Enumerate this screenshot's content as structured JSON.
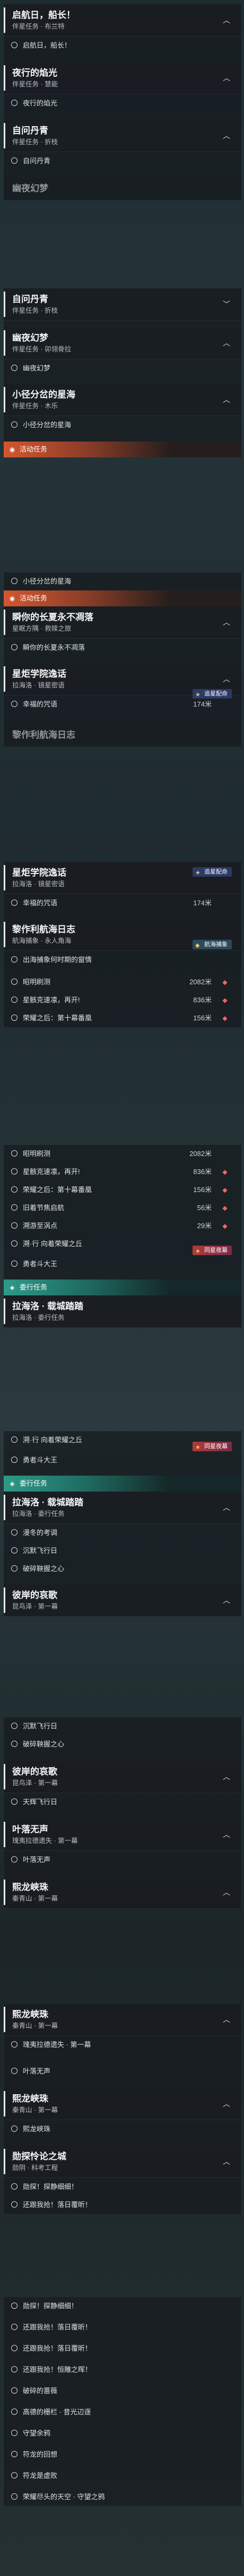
{
  "seg1": {
    "q1": {
      "title": "启航日，船长！",
      "sub": "伴星任务 · 布兰特"
    },
    "q1s1": "启航日，船长！",
    "q2": {
      "title": "夜行的焰光",
      "sub": "伴星任务 · 慧能"
    },
    "q2s1": "夜行的焰光",
    "q3": {
      "title": "自问丹青",
      "sub": "伴星任务 · 折枝"
    },
    "q3s1": "自问丹青",
    "q4": {
      "title": "幽夜幻梦"
    }
  },
  "seg2": {
    "q1": {
      "title": "自问丹青",
      "sub": "伴星任务 · 折枝"
    },
    "q2": {
      "title": "幽夜幻梦",
      "sub": "伴星任务 · 卯翎骨拉"
    },
    "q2s1": "幽夜幻梦",
    "q3": {
      "title": "小径分岔的星海",
      "sub": "伴星任务 · 木乐"
    },
    "q3s1": "小径分岔的星海",
    "cat": "活动任务"
  },
  "seg3": {
    "step0": "小径分岔的星海",
    "cat": "活动任务",
    "q1": {
      "title": "瞬你的长夏永不凋落",
      "sub": "星眠方隅 · 救赎之旅"
    },
    "q1s1": "瞬你的长夏永不凋落",
    "q2": {
      "title": "星炬学院逸话",
      "sub": "拉海洛 · 镜星密语"
    },
    "q2s1": "幸福的咒语",
    "q2s1d": "174米",
    "badge": "追星配命",
    "q3": {
      "title": "黎作利航海日志"
    }
  },
  "seg4": {
    "q1": {
      "title": "星炬学院逸话",
      "sub": "拉海洛 · 镜星密语"
    },
    "badge": "追星配命",
    "q1s1": "幸福的咒语",
    "q1s1d": "174米",
    "q2": {
      "title": "黎作利航海日志",
      "sub": "航海捕象 · 永人角海"
    },
    "q2s1": "出海捕象何时期的窗情",
    "badge2": "航海捕象",
    "s1": "昭明刷测",
    "s1d": "2082米",
    "s2": "星骸克速凛，再开!",
    "s2d": "836米",
    "s3": "荣耀之后：第十幕番凰",
    "s3d": "156米"
  },
  "seg5": {
    "s0": "昭明刷测",
    "s0d": "2082米",
    "s1": "星骸克速凛，再开!",
    "s1d": "836米",
    "s2": "荣耀之后：第十幕番凰",
    "s2d": "156米",
    "s3": "旧着节焦启航",
    "s3d": "56米",
    "s4": "溯游至涡点",
    "s4d": "29米",
    "s5": "溯·行 向着荣耀之丘",
    "badge": "同星夜幕",
    "s6": "勇者斗大王",
    "cat": "委行任务",
    "q1": {
      "title": "拉海洛 · 载城踏踏",
      "sub": "拉海洛 · 委行任务"
    }
  },
  "seg6": {
    "s1": "溯·行 向着荣耀之丘",
    "badge": "同星夜幕",
    "s2": "勇者斗大王",
    "cat": "委行任务",
    "q1": {
      "title": "拉海洛 · 载城踏踏",
      "sub": "拉海洛 · 委行任务"
    },
    "q1s1": "漫冬的考调",
    "q1s2": "沉默飞行日",
    "q1s3": "破碎鞅握之心",
    "q2": {
      "title": "彼岸的哀歌",
      "sub": "昆鸟泽 · 第一幕"
    }
  },
  "seg7": {
    "s1": "沉默飞行日",
    "s2": "破碎鞅握之心",
    "q1": {
      "title": "彼岸的哀歌",
      "sub": "昆鸟泽 · 第一幕"
    },
    "q1s1": "天辉飞行日",
    "q2": {
      "title": "叶落无声",
      "sub": "瑰夷拉德遗失 · 第一幕"
    },
    "q2s1": "叶落无声",
    "q3": {
      "title": "熙龙峡珠",
      "sub": "秦青山 · 第一幕"
    }
  },
  "seg8": {
    "q1": {
      "title": "熙龙峡珠",
      "sub": "秦青山 · 第一幕"
    },
    "q1s1": "瑰夷拉德遗失 · 第一幕",
    "s1": "叶落无声",
    "q2": {
      "title": "熙龙峡珠",
      "sub": "秦青山 · 第一幕"
    },
    "q2s1": "熙龙峡珠",
    "q3": {
      "title": "勋探怜论之城",
      "sub": "勋阴 · 科考工程"
    },
    "q3s1": "勋探！探静细细！",
    "q3s2": "还跟我抢！落日覆昕！"
  },
  "seg9": {
    "s1": "勋探！探静细细！",
    "s2": "还跟我抢！落日覆昕！",
    "s3": "还跟我抢！落日覆昕！",
    "s4": "还跟我抢！恒雕之晖！",
    "s5": "破碎的蔷薇",
    "s6": "高德的栅栏 · 昔光辺逐",
    "s7": "守望余鸦",
    "s8": "符龙的回想",
    "s9": "符龙是虚败",
    "s10": "荣耀尽头的天空 · 守望之鸦"
  }
}
